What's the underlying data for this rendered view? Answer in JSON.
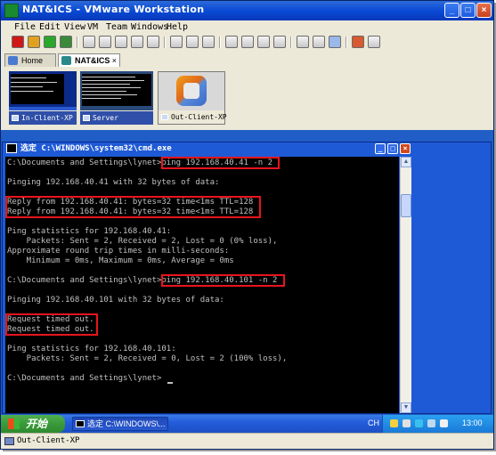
{
  "window": {
    "title": "NAT&ICS - VMware Workstation"
  },
  "menu": [
    "File",
    "Edit",
    "View",
    "VM",
    "Team",
    "Windows",
    "Help"
  ],
  "tabs": [
    {
      "label": "Home",
      "active": false
    },
    {
      "label": "NAT&ICS",
      "active": true
    }
  ],
  "thumbnails": [
    {
      "label": "In-Client-XP"
    },
    {
      "label": "Server"
    },
    {
      "label": "Out-Client-XP"
    }
  ],
  "cmd": {
    "title": "选定 C:\\WINDOWS\\system32\\cmd.exe",
    "lines": [
      "C:\\Documents and Settings\\lynet>ping 192.168.40.41 -n 2",
      "",
      "Pinging 192.168.40.41 with 32 bytes of data:",
      "",
      "Reply from 192.168.40.41: bytes=32 time<1ms TTL=128",
      "Reply from 192.168.40.41: bytes=32 time<1ms TTL=128",
      "",
      "Ping statistics for 192.168.40.41:",
      "    Packets: Sent = 2, Received = 2, Lost = 0 (0% loss),",
      "Approximate round trip times in milli-seconds:",
      "    Minimum = 0ms, Maximum = 0ms, Average = 0ms",
      "",
      "C:\\Documents and Settings\\lynet>ping 192.168.40.101 -n 2",
      "",
      "Pinging 192.168.40.101 with 32 bytes of data:",
      "",
      "Request timed out.",
      "Request timed out.",
      "",
      "Ping statistics for 192.168.40.101:",
      "    Packets: Sent = 2, Received = 0, Lost = 2 (100% loss),",
      "",
      "C:\\Documents and Settings\\lynet>"
    ]
  },
  "taskbar": {
    "start": "开始",
    "task": "选定 C:\\WINDOWS\\...",
    "lang": "CH",
    "clock": "13:00"
  },
  "statusbar": {
    "text": "Out-Client-XP"
  },
  "colors": {
    "title_blue": "#0a4ad6",
    "console_bg": "#000000",
    "console_text": "#c0c0c0",
    "highlight_red": "#e8141c",
    "start_green": "#3a9a3a"
  }
}
